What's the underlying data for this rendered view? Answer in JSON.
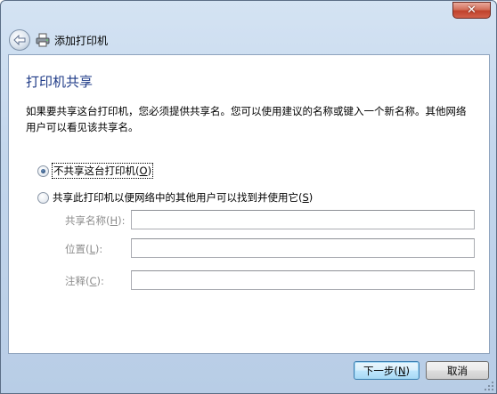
{
  "titlebar": {
    "close_glyph": "✕",
    "close_icon": "close-icon"
  },
  "navbar": {
    "back_icon": "back-arrow-icon",
    "app_icon": "printer-icon",
    "title": "添加打印机"
  },
  "page": {
    "heading": "打印机共享",
    "description": "如果要共享这台打印机，您必须提供共享名。您可以使用建议的名称或键入一个新名称。其他网络用户可以看见该共享名。"
  },
  "options": {
    "no_share": {
      "label": "不共享这台打印机(",
      "accel": "O",
      "suffix": ")",
      "checked": true
    },
    "share": {
      "label": "共享此打印机以便网络中的其他用户可以找到并使用它(",
      "accel": "S",
      "suffix": ")",
      "checked": false
    }
  },
  "fields": {
    "share_name": {
      "label": "共享名称(",
      "accel": "H",
      "suffix": "):",
      "value": ""
    },
    "location": {
      "label": "位置(",
      "accel": "L",
      "suffix": "):",
      "value": ""
    },
    "comment": {
      "label": "注释(",
      "accel": "C",
      "suffix": "):",
      "value": ""
    }
  },
  "buttons": {
    "next": {
      "label": "下一步(",
      "accel": "N",
      "suffix": ")"
    },
    "cancel": {
      "label": "取消"
    }
  },
  "colors": {
    "heading": "#1f3b87",
    "disabled_text": "#8d8d8d",
    "close_button": "#c0422b"
  }
}
